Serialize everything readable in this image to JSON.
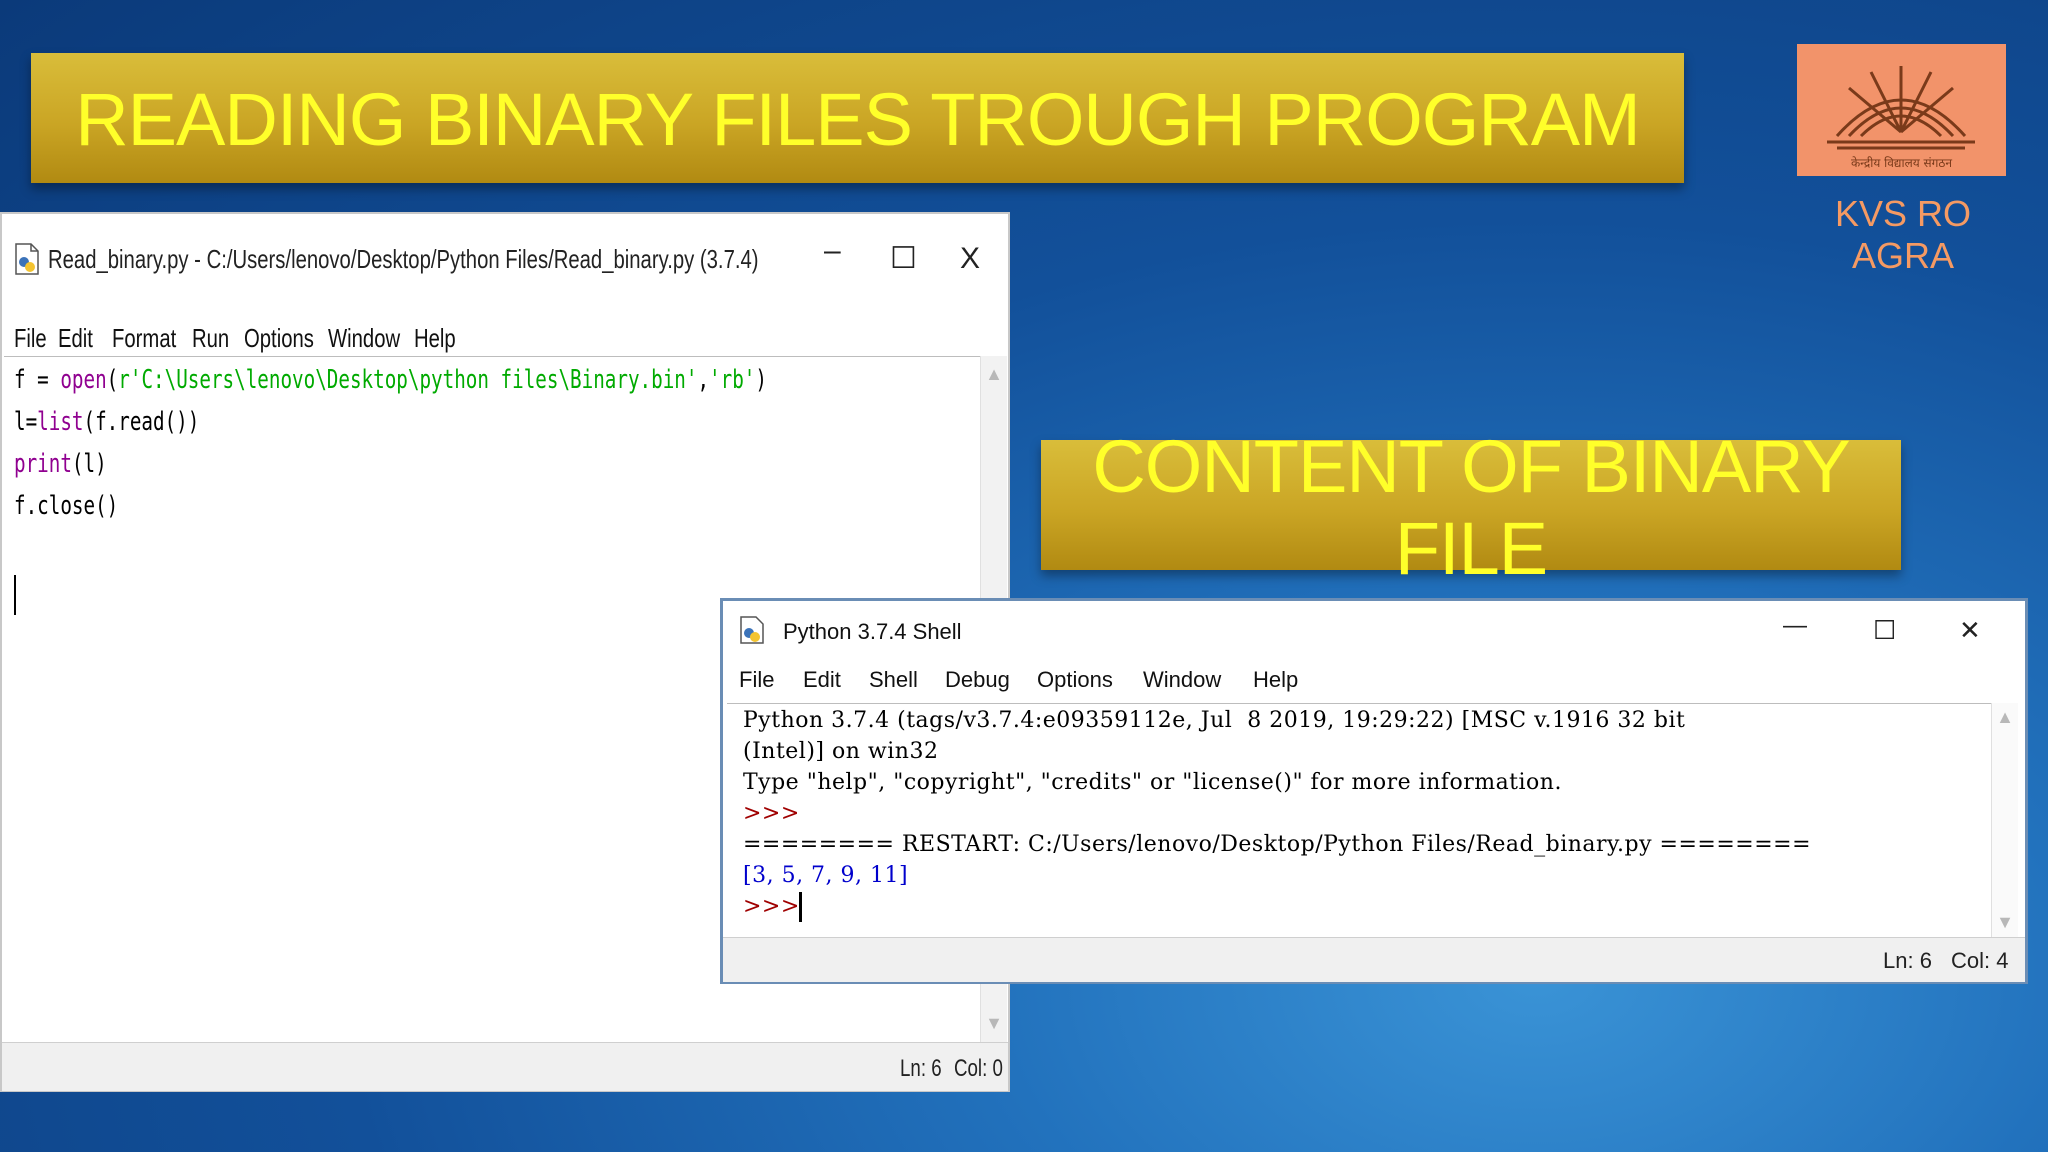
{
  "slide": {
    "title": "READING BINARY FILES TROUGH PROGRAM",
    "content_banner": "CONTENT OF BINARY FILE",
    "logo_caption": "KVS RO AGRA",
    "logo_text": "केन्द्रीय विद्यालय संगठन"
  },
  "editor": {
    "title": "Read_binary.py - C:/Users/lenovo/Desktop/Python Files/Read_binary.py (3.7.4)",
    "menu": [
      "File",
      "Edit",
      "Format",
      "Run",
      "Options",
      "Window",
      "Help"
    ],
    "code": [
      {
        "parts": [
          {
            "t": "f = ",
            "c": "#000000"
          },
          {
            "t": "open",
            "c": "#900090"
          },
          {
            "t": "(",
            "c": "#000000"
          },
          {
            "t": "r'C:\\Users\\lenovo\\Desktop\\python files\\Binary.bin'",
            "c": "#00aa00"
          },
          {
            "t": ",",
            "c": "#000000"
          },
          {
            "t": "'rb'",
            "c": "#00aa00"
          },
          {
            "t": ")",
            "c": "#000000"
          }
        ]
      },
      {
        "parts": [
          {
            "t": "l=",
            "c": "#000000"
          },
          {
            "t": "list",
            "c": "#900090"
          },
          {
            "t": "(f.read())",
            "c": "#000000"
          }
        ]
      },
      {
        "parts": [
          {
            "t": "print",
            "c": "#900090"
          },
          {
            "t": "(l)",
            "c": "#000000"
          }
        ]
      },
      {
        "parts": [
          {
            "t": "f.close()",
            "c": "#000000"
          }
        ]
      }
    ],
    "status_ln": "Ln: 6",
    "status_col": "Col: 0",
    "ctrl_minimize": "–",
    "ctrl_maximize": "☐",
    "ctrl_close": "X"
  },
  "shell": {
    "title": "Python 3.7.4 Shell",
    "menu": [
      "File",
      "Edit",
      "Shell",
      "Debug",
      "Options",
      "Window",
      "Help"
    ],
    "lines": [
      {
        "t": "Python 3.7.4 (tags/v3.7.4:e09359112e, Jul  8 2019, 19:29:22) [MSC v.1916 32 bit",
        "c": "#000000"
      },
      {
        "t": "(Intel)] on win32",
        "c": "#000000"
      },
      {
        "t": "Type \"help\", \"copyright\", \"credits\" or \"license()\" for more information.",
        "c": "#000000"
      },
      {
        "t": ">>>",
        "c": "#a00000"
      },
      {
        "t": "======== RESTART: C:/Users/lenovo/Desktop/Python Files/Read_binary.py ========",
        "c": "#000000"
      },
      {
        "t": "[3, 5, 7, 9, 11]",
        "c": "#0000cc"
      },
      {
        "t": ">>> ",
        "c": "#a00000"
      }
    ],
    "status_ln": "Ln: 6",
    "status_col": "Col: 4",
    "ctrl_minimize": "—",
    "ctrl_maximize": "☐",
    "ctrl_close": "✕"
  }
}
